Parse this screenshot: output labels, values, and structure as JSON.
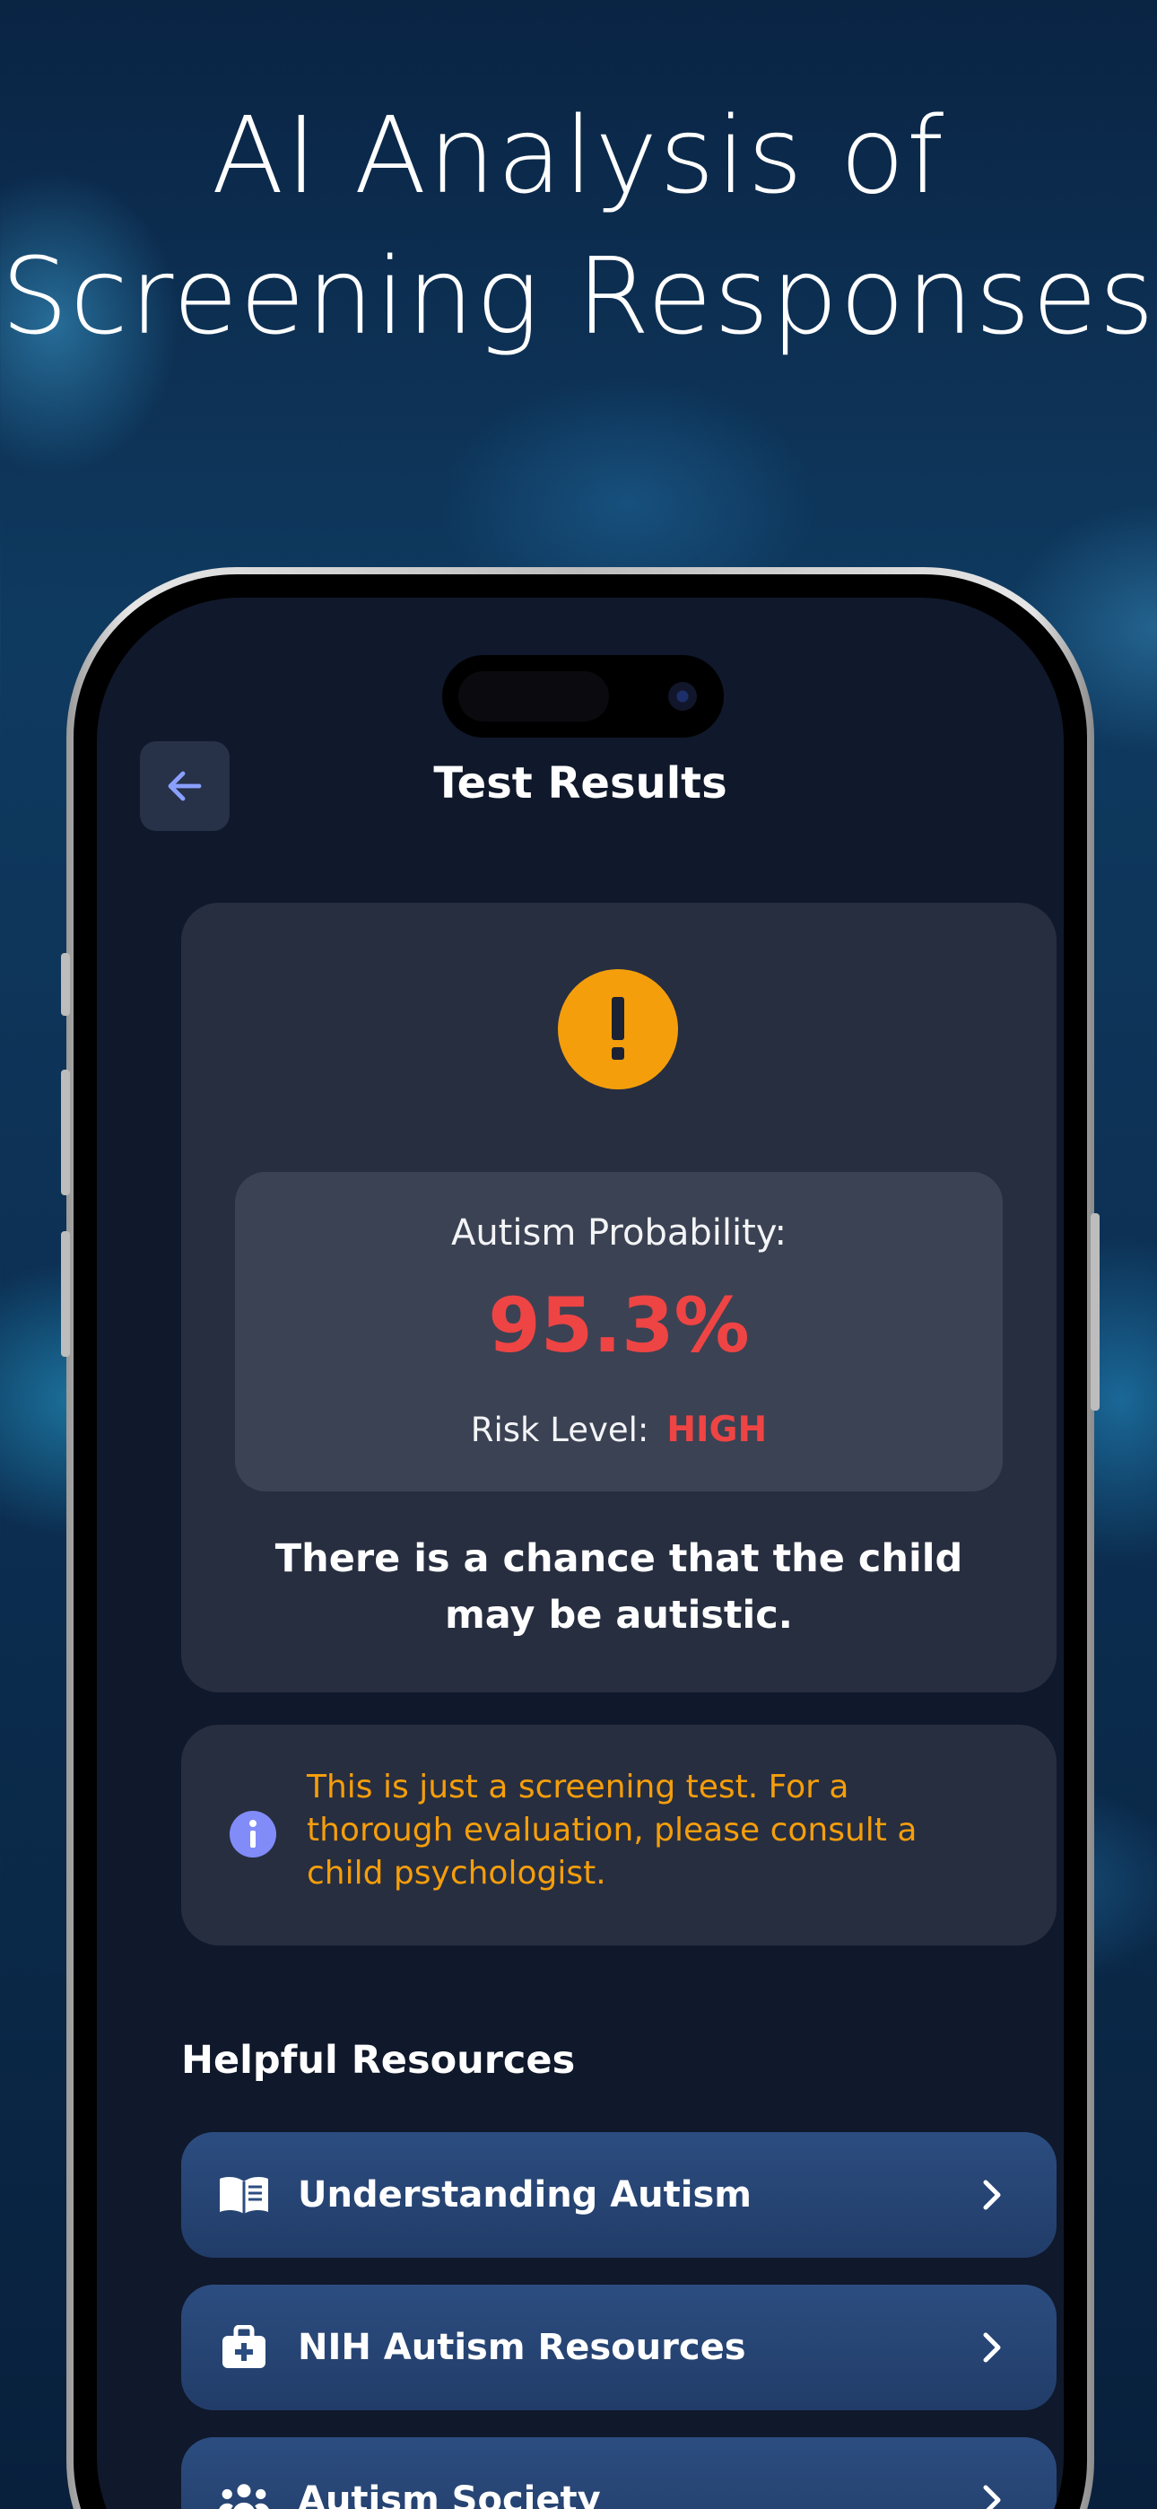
{
  "headline": "AI Analysis of Screening Responses",
  "header": {
    "title": "Test Results",
    "back_icon": "arrow-left-icon"
  },
  "result": {
    "alert_icon": "exclamation-circle-icon",
    "probability_label": "Autism Probability:",
    "probability_value": "95.3%",
    "risk_label": "Risk Level:",
    "risk_value": "HIGH",
    "message": "There is a chance that the child may be autistic."
  },
  "notice": {
    "icon": "info-icon",
    "text": "This is just a screening test. For a thorough evaluation, please consult a child psychologist."
  },
  "resources": {
    "title": "Helpful Resources",
    "items": [
      {
        "label": "Understanding Autism",
        "icon": "book-open-icon"
      },
      {
        "label": "NIH Autism Resources",
        "icon": "medical-kit-icon"
      },
      {
        "label": "Autism Society",
        "icon": "people-group-icon"
      }
    ]
  },
  "colors": {
    "screen_bg": "#10182b",
    "card_bg": "#272e40",
    "accent_orange": "#f59e0b",
    "danger_red": "#ef4444",
    "info_purple": "#818cf8",
    "resource_blue": "#2c4d80"
  }
}
